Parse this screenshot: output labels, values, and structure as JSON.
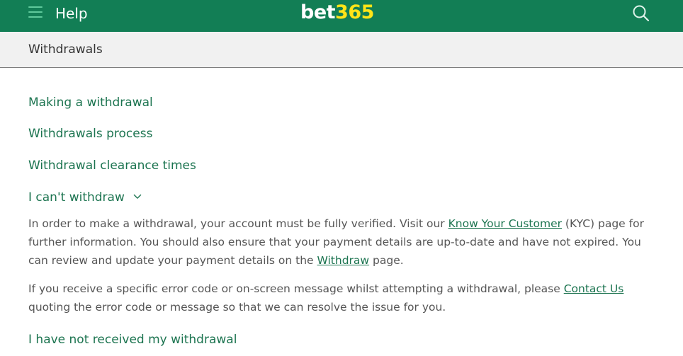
{
  "header": {
    "help_label": "Help",
    "logo_bet": "bet",
    "logo_num": "365",
    "menu_icon": "hamburger-menu-icon",
    "search_icon": "search-icon",
    "brand_color": "#127e55",
    "logo_accent": "#ffe418"
  },
  "subheader": {
    "title": "Withdrawals"
  },
  "topics": [
    {
      "label": "Making a withdrawal"
    },
    {
      "label": "Withdrawals process"
    },
    {
      "label": "Withdrawal clearance times"
    },
    {
      "label": "I can't withdraw",
      "expanded": true
    },
    {
      "label": "I have not received my withdrawal"
    }
  ],
  "expanded": {
    "p1": {
      "t1": "In order to make a withdrawal, your account must be fully verified. Visit our ",
      "link1": "Know Your Customer",
      "t2": " (KYC) page for further information. You should also ensure that your payment details are up-to-date and have not expired. You can review and update your payment details on the ",
      "link2": "Withdraw",
      "t3": " page."
    },
    "p2": {
      "t1": "If you receive a specific error code or on-screen message whilst attempting a withdrawal, please ",
      "link1": "Contact Us",
      "t2": " quoting the error code or message so that we can resolve the issue for you."
    }
  }
}
